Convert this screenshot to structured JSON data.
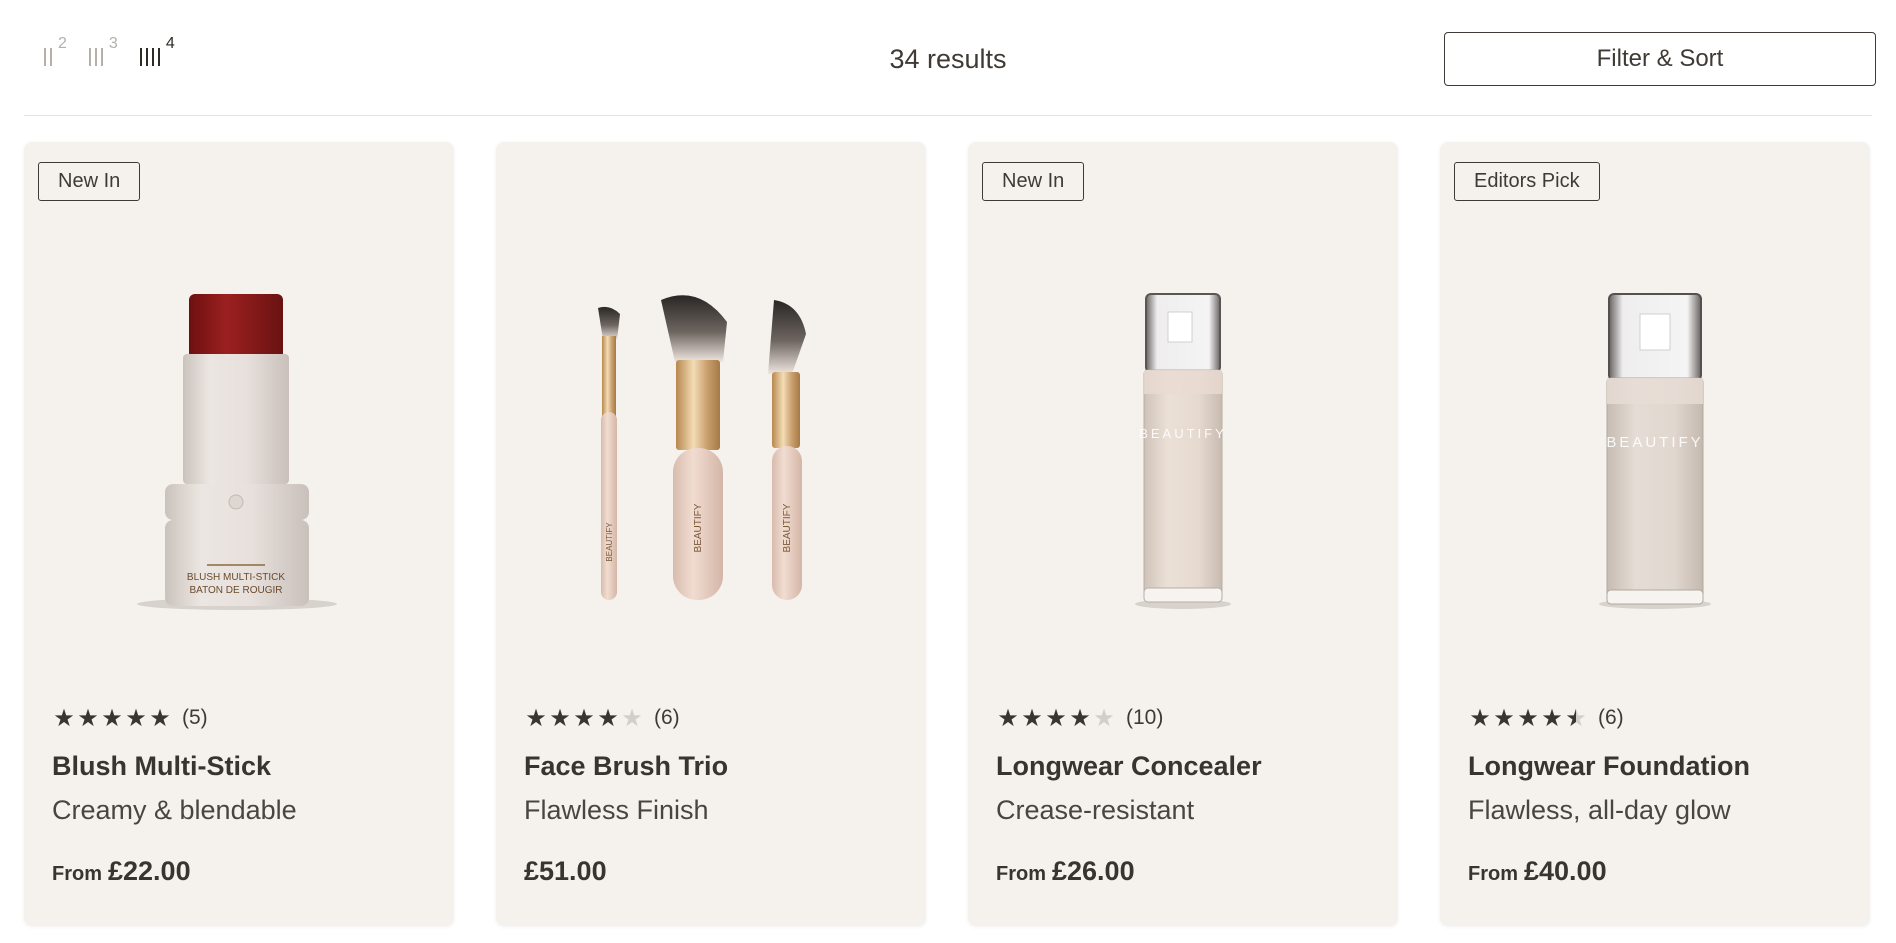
{
  "toolbar": {
    "grid_options": [
      {
        "label": "2",
        "bars": 2,
        "active": false
      },
      {
        "label": "3",
        "bars": 3,
        "active": false
      },
      {
        "label": "4",
        "bars": 4,
        "active": true
      }
    ],
    "results": "34 results",
    "filter_sort": "Filter & Sort"
  },
  "products": [
    {
      "badge": "New In",
      "rating": 5,
      "reviews": "(5)",
      "name": "Blush Multi-Stick",
      "desc": "Creamy & blendable",
      "from": "From",
      "price": "£22.00",
      "image": "blush-stick",
      "label_lines": [
        "BLUSH MULTI-STICK",
        "BATON DE ROUGIR"
      ]
    },
    {
      "badge": "",
      "rating": 4,
      "reviews": "(6)",
      "name": "Face Brush Trio",
      "desc": "Flawless Finish",
      "from": "",
      "price": "£51.00",
      "image": "brush-trio",
      "brand": "BEAUTIFY"
    },
    {
      "badge": "New In",
      "rating": 4,
      "reviews": "(10)",
      "name": "Longwear Concealer",
      "desc": "Crease-resistant",
      "from": "From",
      "price": "£26.00",
      "image": "pump-bottle-slim",
      "brand": "BEAUTIFY"
    },
    {
      "badge": "Editors Pick",
      "rating": 4.5,
      "reviews": "(6)",
      "name": "Longwear Foundation",
      "desc": "Flawless, all-day glow",
      "from": "From",
      "price": "£40.00",
      "image": "pump-bottle-wide",
      "brand": "BEAUTIFY"
    }
  ],
  "colors": {
    "card_bg": "#f5f2ee",
    "text": "#3a3430",
    "star": "#3b352f",
    "star_empty": "#d2cec9",
    "blush_cap": "#8c1a1a",
    "gold": "#c9a06a",
    "brush_handle": "#e8cfc3"
  }
}
